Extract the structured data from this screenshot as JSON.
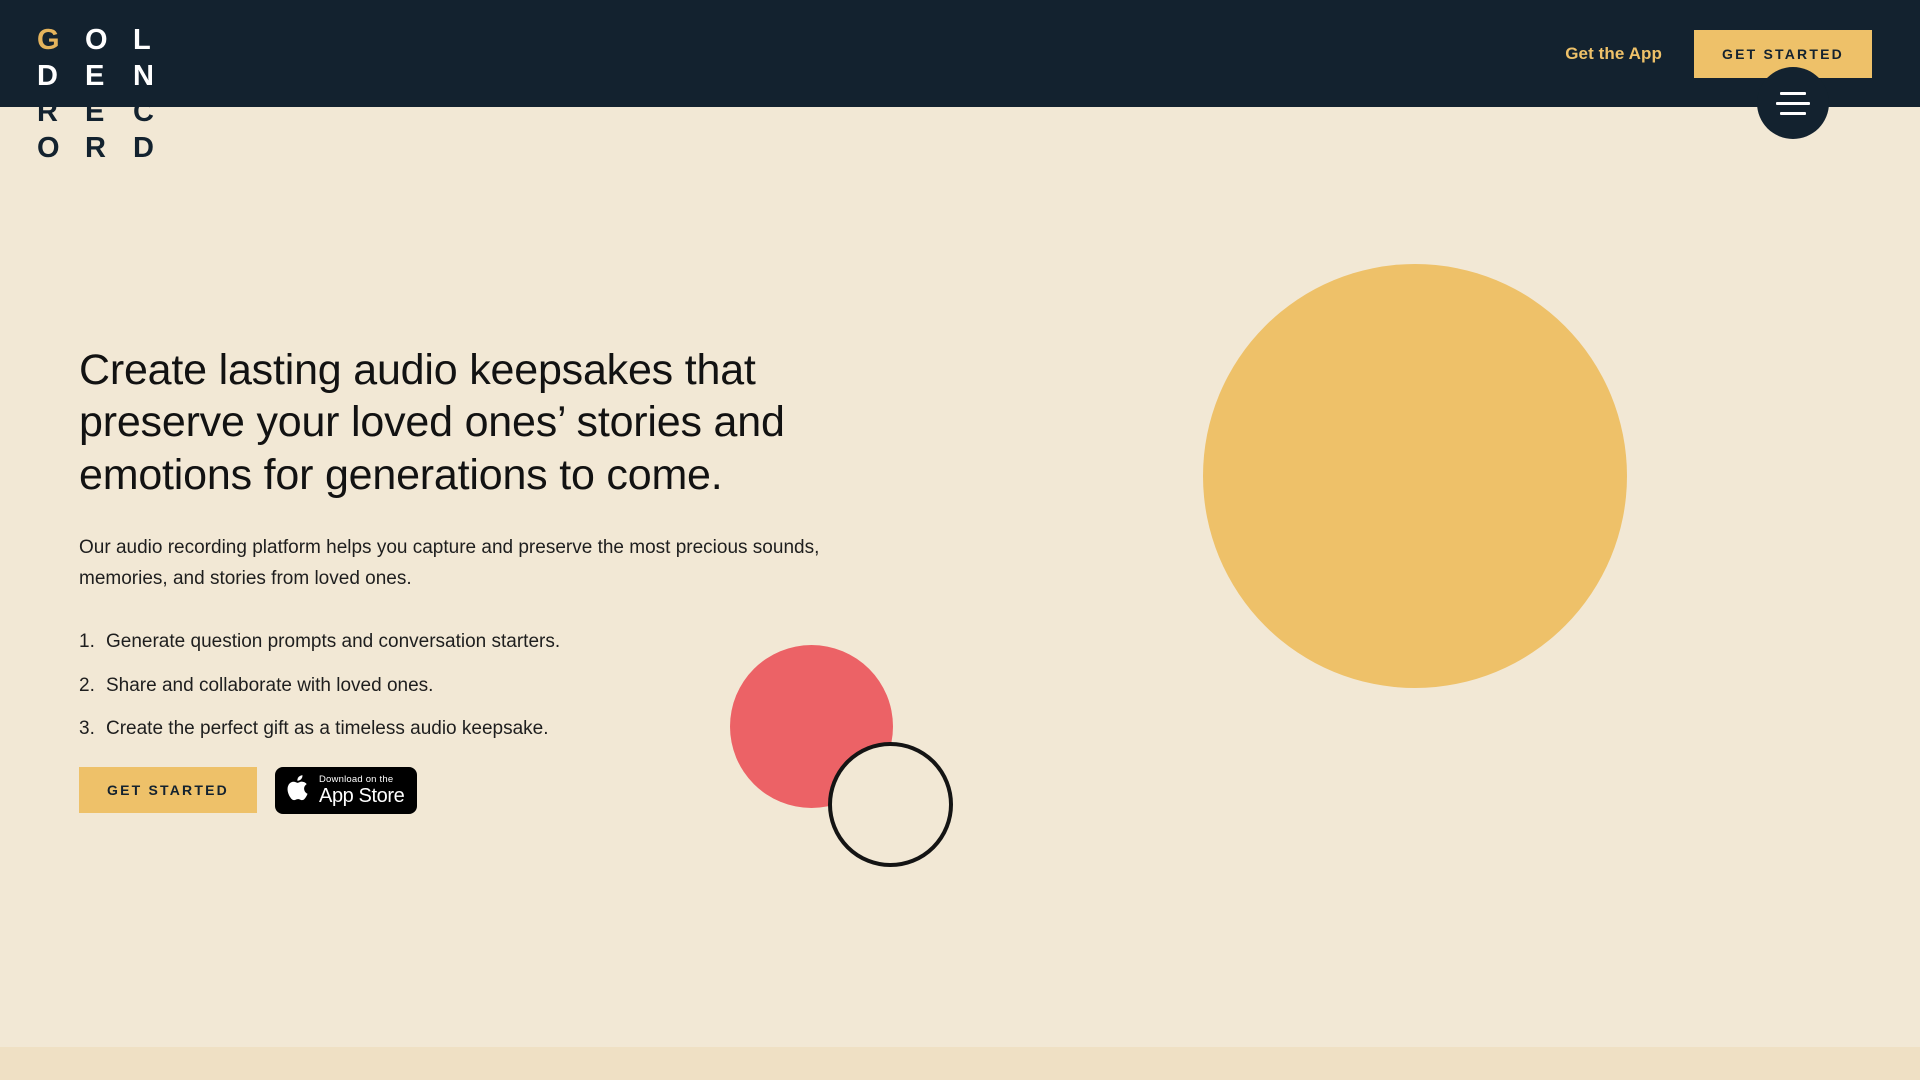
{
  "brand": {
    "name": "Golden Record",
    "logo_rows": [
      [
        {
          "char": "G",
          "color": "gold"
        },
        {
          "char": "O",
          "color": "white"
        },
        {
          "char": "L",
          "color": "white"
        }
      ],
      [
        {
          "char": "D",
          "color": "white"
        },
        {
          "char": "E",
          "color": "white"
        },
        {
          "char": "N",
          "color": "white"
        }
      ],
      [
        {
          "char": "R",
          "color": "navy"
        },
        {
          "char": "E",
          "color": "navy"
        },
        {
          "char": "C",
          "color": "navy"
        }
      ],
      [
        {
          "char": "O",
          "color": "navy"
        },
        {
          "char": "R",
          "color": "navy"
        },
        {
          "char": "D",
          "color": "navy"
        }
      ]
    ]
  },
  "colors": {
    "navy": "#13222F",
    "gold": "#EEC169",
    "logo_gold": "#E4B35C",
    "cream": "#F2E8D5",
    "cream_dark": "#EFE0C4",
    "coral": "#EC6266",
    "outline": "#141414",
    "text": "#121212",
    "white": "#FFFFFF",
    "black": "#000000"
  },
  "header": {
    "get_app_label": "Get the App",
    "cta_label": "GET STARTED",
    "menu_icon": "hamburger-icon"
  },
  "hero": {
    "headline": "Create lasting audio keepsakes that preserve your loved ones’ stories and emotions for generations to come.",
    "subhead": "Our audio recording platform helps you capture and preserve the most precious sounds, memories, and stories from loved ones.",
    "steps": [
      {
        "num": "1.",
        "text": "Generate question prompts and conversation starters."
      },
      {
        "num": "2.",
        "text": "Share and collaborate with loved ones."
      },
      {
        "num": "3.",
        "text": "Create the perfect gift as a timeless audio keepsake."
      }
    ],
    "cta_label": "GET STARTED",
    "appstore": {
      "small_label": "Download on the",
      "big_label": "App Store",
      "icon": "apple-logo-icon"
    }
  },
  "decor": {
    "gold_circle": "gold-circle",
    "coral_circle": "coral-circle",
    "outline_circle": "outline-circle"
  }
}
